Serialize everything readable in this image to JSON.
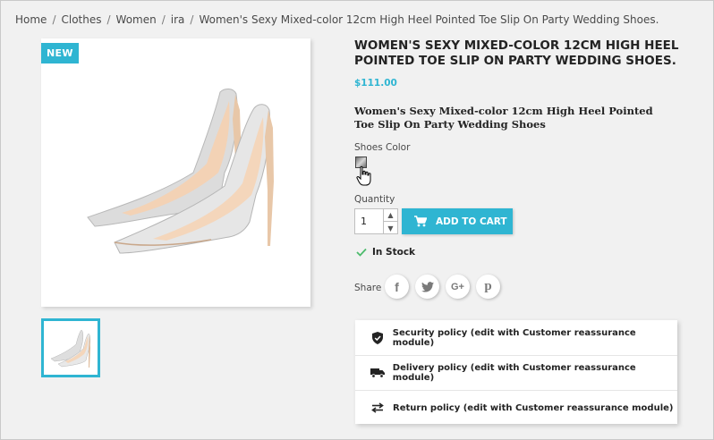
{
  "breadcrumb": [
    "Home",
    "Clothes",
    "Women",
    "ira",
    "Women's Sexy Mixed-color 12cm High Heel Pointed Toe Slip On Party Wedding Shoes."
  ],
  "badge": "NEW",
  "product": {
    "title": "WOMEN'S SEXY MIXED-COLOR 12CM HIGH HEEL POINTED TOE SLIP ON PARTY WEDDING SHOES.",
    "price": "$111.00",
    "description": "Women's Sexy Mixed-color 12cm High Heel Pointed Toe Slip On Party Wedding Shoes"
  },
  "variant": {
    "label": "Shoes Color"
  },
  "quantity": {
    "label": "Quantity",
    "value": "1"
  },
  "add_to_cart": "ADD TO CART",
  "stock": "In Stock",
  "share_label": "Share",
  "reassurance": [
    "Security policy (edit with Customer reassurance module)",
    "Delivery policy (edit with Customer reassurance module)",
    "Return policy (edit with Customer reassurance module)"
  ],
  "colors": {
    "accent": "#2fb5d2",
    "check": "#4cbb6c"
  }
}
